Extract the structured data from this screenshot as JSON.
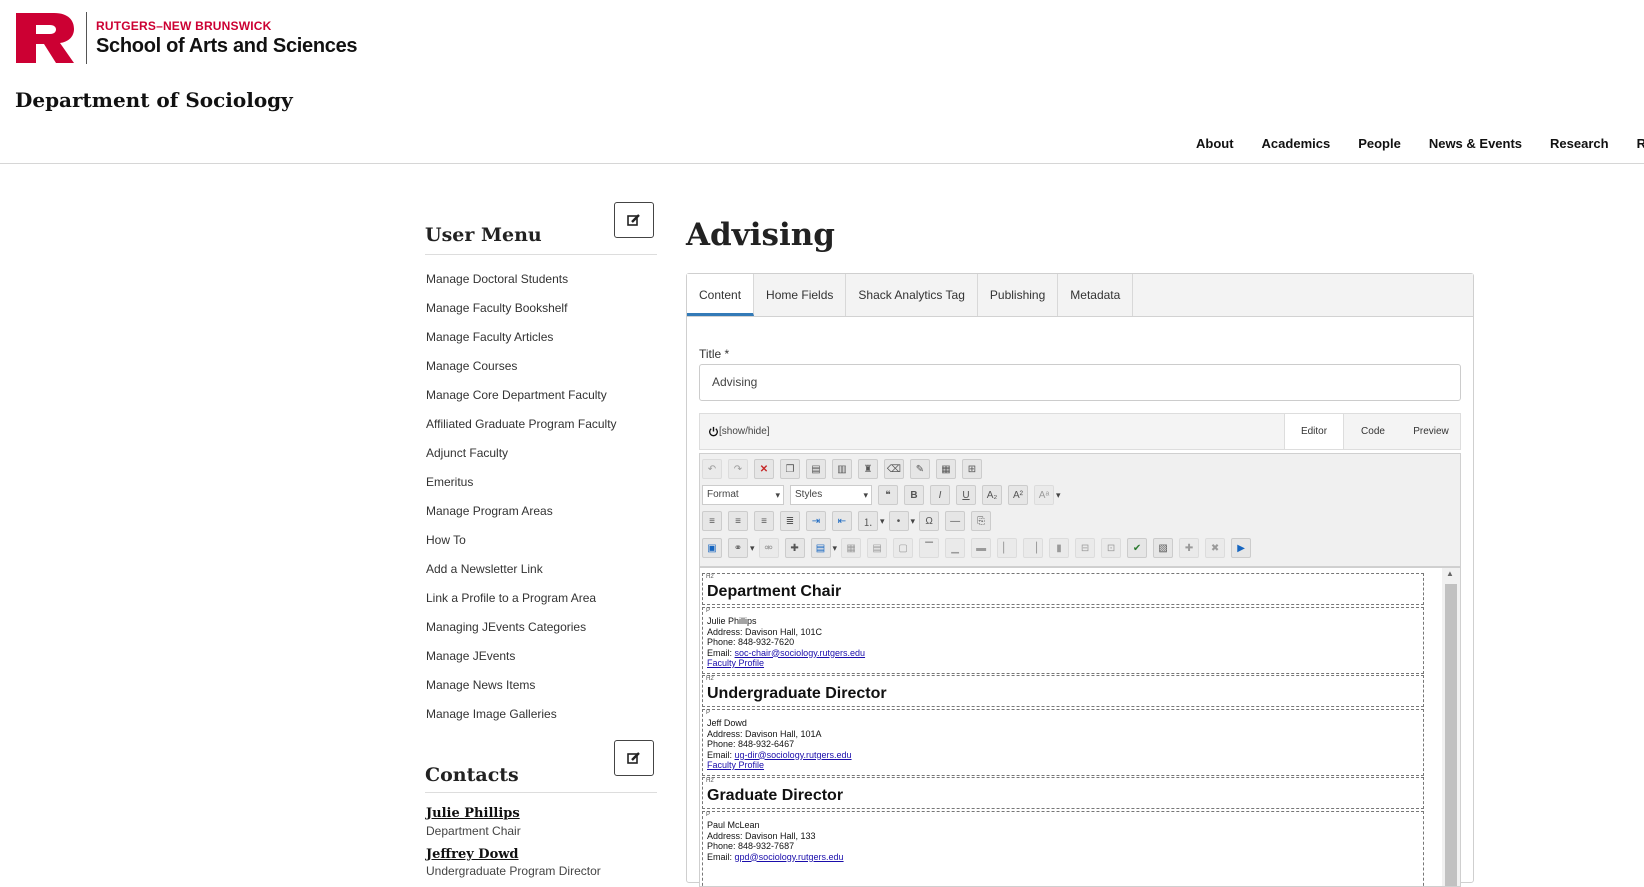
{
  "header": {
    "logo_letter": "R",
    "brand_top": "RUTGERS–NEW BRUNSWICK",
    "brand_bottom": "School of Arts and Sciences",
    "department": "Department of Sociology",
    "nav": [
      "About",
      "Academics",
      "People",
      "News & Events",
      "Research",
      "Re"
    ]
  },
  "sidebar": {
    "user_menu_title": "User Menu",
    "menu_items": [
      "Manage Doctoral Students",
      "Manage Faculty Bookshelf",
      "Manage Faculty Articles",
      "Manage Courses",
      "Manage Core Department Faculty",
      "Affiliated Graduate Program Faculty",
      "Adjunct Faculty",
      "Emeritus",
      "Manage Program Areas",
      "How To",
      "Add a Newsletter Link",
      "Link a Profile to a Program Area",
      "Managing JEvents Categories",
      "Manage JEvents",
      "Manage News Items",
      "Manage Image Galleries"
    ],
    "contacts_title": "Contacts",
    "contacts": [
      {
        "name": "Julie Phillips",
        "role": "Department Chair"
      },
      {
        "name": "Jeffrey Dowd",
        "role": "Undergraduate Program Director"
      }
    ]
  },
  "main": {
    "page_title": "Advising",
    "tabs": [
      "Content",
      "Home Fields",
      "Shack Analytics Tag",
      "Publishing",
      "Metadata"
    ],
    "active_tab": "Content",
    "title_label": "Title *",
    "title_value": "Advising",
    "editor": {
      "show_hide": "[show/hide]",
      "modes": [
        "Editor",
        "Code",
        "Preview"
      ],
      "active_mode": "Editor",
      "format_label": "Format",
      "styles_label": "Styles"
    },
    "content": {
      "h2_tag": "H2",
      "p_tag": "P",
      "sections": [
        {
          "heading": "Department Chair",
          "name": "Julie Phillips",
          "address": "Address: Davison Hall, 101C",
          "phone": "Phone: 848-932-7620",
          "email_label": "Email:",
          "email": "soc-chair@sociology.rutgers.edu",
          "profile": "Faculty Profile"
        },
        {
          "heading": "Undergraduate Director",
          "name": "Jeff Dowd",
          "address": "Address: Davison Hall, 101A",
          "phone": "Phone: 848-932-6467",
          "email_label": "Email:",
          "email": "ug-dir@sociology.rutgers.edu",
          "profile": "Faculty Profile"
        },
        {
          "heading": "Graduate Director",
          "name": "Paul McLean",
          "address": "Address: Davison Hall, 133",
          "phone": "Phone: 848-932-7687",
          "email_label": "Email:",
          "email": "gpd@sociology.rutgers.edu",
          "profile": ""
        }
      ]
    }
  },
  "icons": {
    "edit": "edit-icon",
    "power": "power-icon"
  },
  "colors": {
    "brand_red": "#cc0033",
    "tab_accent": "#337ab7"
  }
}
